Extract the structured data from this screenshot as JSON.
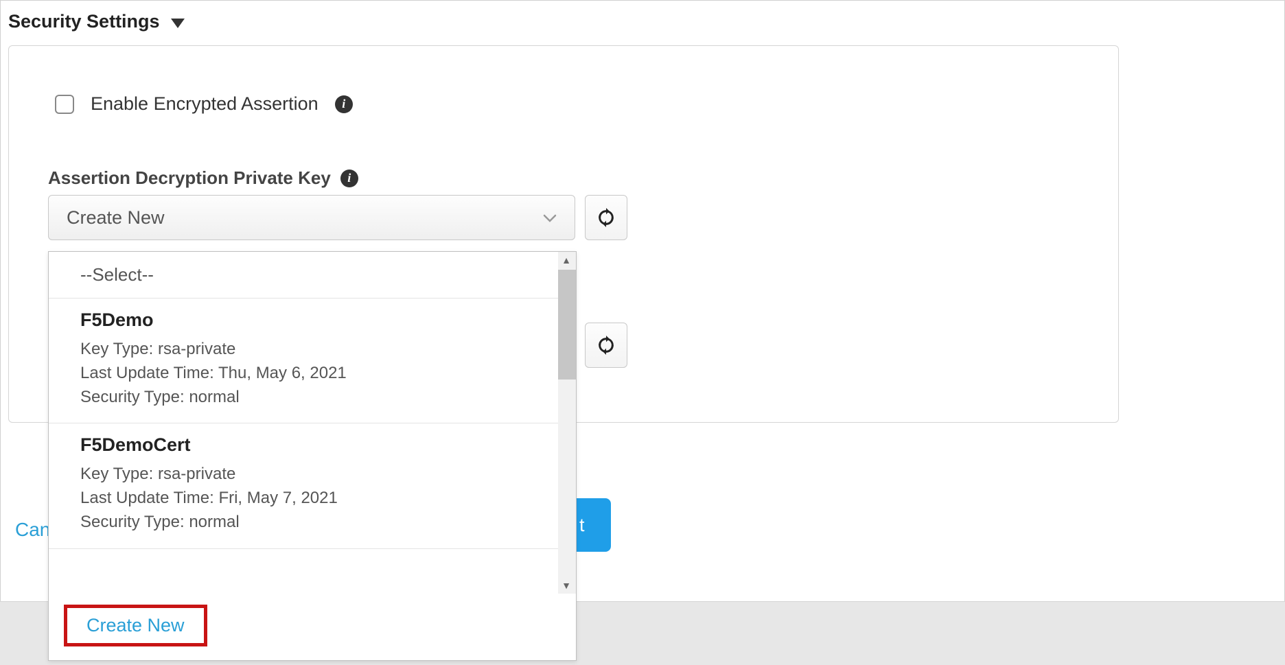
{
  "section": {
    "title": "Security Settings"
  },
  "checkbox": {
    "label": "Enable Encrypted Assertion"
  },
  "field": {
    "label": "Assertion Decryption Private Key",
    "selected": "Create New"
  },
  "dropdown": {
    "placeholder": "--Select--",
    "items": [
      {
        "name": "F5Demo",
        "key_type_label": "Key Type:",
        "key_type": "rsa-private",
        "last_update_label": "Last Update Time:",
        "last_update": "Thu, May 6, 2021",
        "security_type_label": "Security Type:",
        "security_type": "normal"
      },
      {
        "name": "F5DemoCert",
        "key_type_label": "Key Type:",
        "key_type": "rsa-private",
        "last_update_label": "Last Update Time:",
        "last_update": "Fri, May 7, 2021",
        "security_type_label": "Security Type:",
        "security_type": "normal"
      }
    ],
    "create_new": "Create New"
  },
  "footer": {
    "cancel": "Can",
    "next_fragment": "t"
  }
}
